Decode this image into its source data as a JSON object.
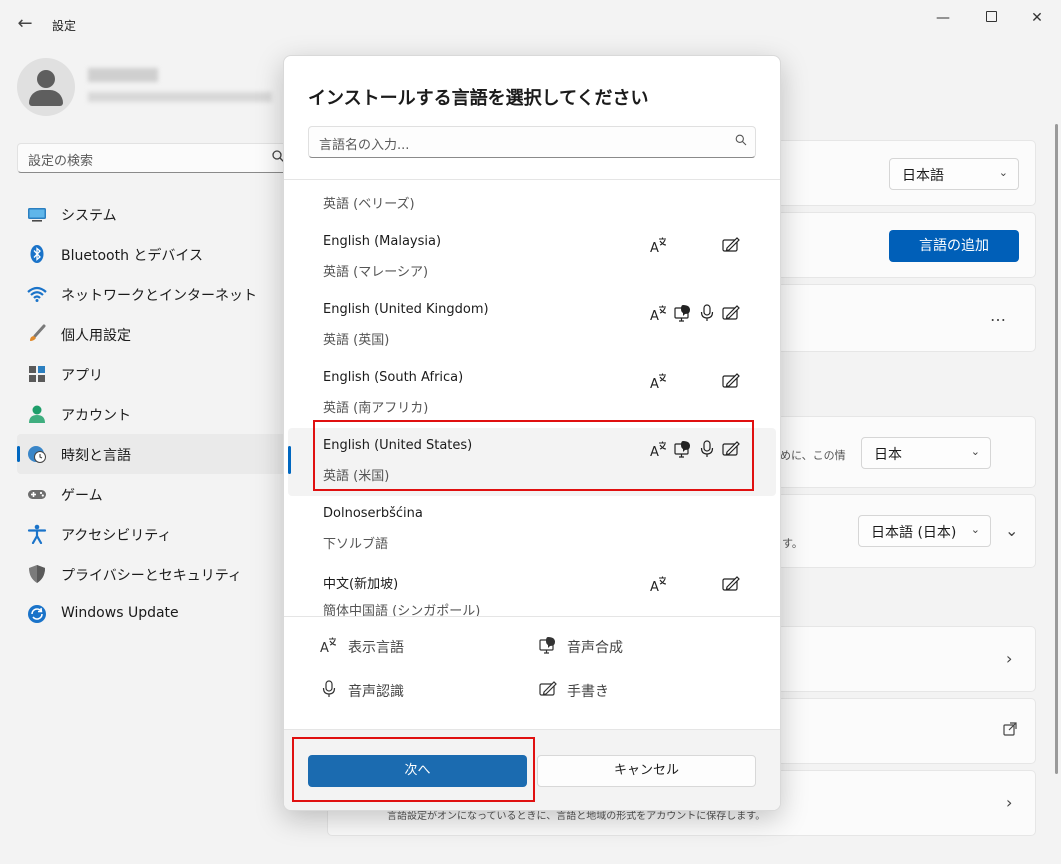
{
  "window": {
    "title": "設定",
    "back_glyph": "←",
    "min_glyph": "—",
    "close_glyph": "✕"
  },
  "sidebar": {
    "search_placeholder": "設定の検索",
    "items": [
      {
        "label": "システム",
        "icon": "monitor-icon"
      },
      {
        "label": "Bluetooth とデバイス",
        "icon": "bluetooth-icon"
      },
      {
        "label": "ネットワークとインターネット",
        "icon": "wifi-icon"
      },
      {
        "label": "個人用設定",
        "icon": "brush-icon"
      },
      {
        "label": "アプリ",
        "icon": "apps-icon"
      },
      {
        "label": "アカウント",
        "icon": "person-icon"
      },
      {
        "label": "時刻と言語",
        "icon": "clock-globe-icon",
        "active": true
      },
      {
        "label": "ゲーム",
        "icon": "gamepad-icon"
      },
      {
        "label": "アクセシビリティ",
        "icon": "accessibility-icon"
      },
      {
        "label": "プライバシーとセキュリティ",
        "icon": "shield-icon"
      },
      {
        "label": "Windows Update",
        "icon": "update-icon"
      }
    ]
  },
  "background": {
    "display_language_value": "日本語",
    "add_language_label": "言語の追加",
    "more_glyph": "…",
    "region_text_fragment": "めに、この情",
    "region_value": "日本",
    "format_text_fragment": "す。",
    "format_value": "日本語 (日本)",
    "sync_text": "言語設定がオンになっているときに、言語と地域の形式をアカウントに保存します。"
  },
  "dialog": {
    "title": "インストールする言語を選択してください",
    "search_placeholder": "言語名の入力...",
    "languages": [
      {
        "en": "",
        "jp": "英語 (ベリーズ)",
        "features": []
      },
      {
        "en": "English (Malaysia)",
        "jp": "英語 (マレーシア)",
        "features": [
          "display",
          "handwriting"
        ]
      },
      {
        "en": "English (United Kingdom)",
        "jp": "英語 (英国)",
        "features": [
          "display",
          "tts",
          "speech",
          "handwriting"
        ]
      },
      {
        "en": "English (South Africa)",
        "jp": "英語 (南アフリカ)",
        "features": [
          "display",
          "handwriting"
        ]
      },
      {
        "en": "English (United States)",
        "jp": "英語 (米国)",
        "features": [
          "display",
          "tts",
          "speech",
          "handwriting"
        ],
        "selected": true
      },
      {
        "en": "Dolnoserbšćina",
        "jp": "下ソルブ語",
        "features": []
      },
      {
        "en": "中文(新加坡)",
        "jp": "簡体中国語 (シンガポール)",
        "features": [
          "display",
          "handwriting"
        ]
      }
    ],
    "legend": {
      "display": "表示言語",
      "tts": "音声合成",
      "speech": "音声認識",
      "handwriting": "手書き"
    },
    "next_label": "次へ",
    "cancel_label": "キャンセル"
  },
  "colors": {
    "accent": "#005fb8",
    "highlight": "#e01010"
  }
}
